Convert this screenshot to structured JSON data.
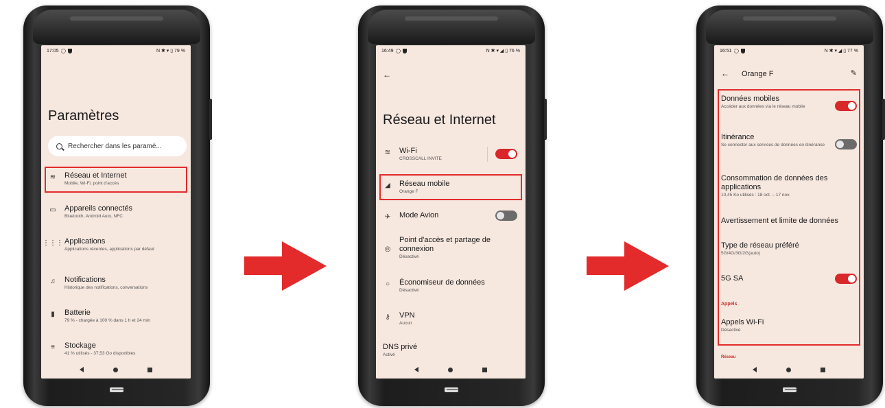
{
  "phone1": {
    "status_time": "17:05",
    "status_right": "N ✱ ▾ ▯ 79 %",
    "title": "Paramètres",
    "search_placeholder": "Rechercher dans les paramè...",
    "items": [
      {
        "title": "Réseau et Internet",
        "subtitle": "Mobile, Wi-Fi, point d'accès",
        "icon": "wifi-icon"
      },
      {
        "title": "Appareils connectés",
        "subtitle": "Bluetooth, Android Auto, NFC",
        "icon": "devices-icon"
      },
      {
        "title": "Applications",
        "subtitle": "Applications récentes, applications par défaut",
        "icon": "apps-grid-icon"
      },
      {
        "title": "Notifications",
        "subtitle": "Historique des notifications, conversations",
        "icon": "bell-icon"
      },
      {
        "title": "Batterie",
        "subtitle": "79 % - chargée à 100 % dans 1 h et 24 min",
        "icon": "battery-icon"
      },
      {
        "title": "Stockage",
        "subtitle": "41 % utilisés - 37,53 Go disponibles",
        "icon": "storage-icon"
      }
    ]
  },
  "phone2": {
    "status_time": "16:49",
    "status_right": "N ✱ ▾ ◢ ▯ 76 %",
    "title": "Réseau et Internet",
    "items": [
      {
        "title": "Wi-Fi",
        "subtitle": "CROSSCALL INVITE",
        "icon": "wifi-icon"
      },
      {
        "title": "Réseau mobile",
        "subtitle": "Orange F",
        "icon": "signal-icon"
      },
      {
        "title": "Mode Avion",
        "subtitle": "",
        "icon": "airplane-icon"
      },
      {
        "title": "Point d'accès et partage de connexion",
        "subtitle": "Désactivé",
        "icon": "hotspot-icon"
      },
      {
        "title": "Économiseur de données",
        "subtitle": "Désactivé",
        "icon": "data-saver-icon"
      },
      {
        "title": "VPN",
        "subtitle": "Aucun",
        "icon": "vpn-key-icon"
      },
      {
        "title": "DNS privé",
        "subtitle": "Activé",
        "icon": ""
      }
    ]
  },
  "phone3": {
    "status_time": "16:51",
    "status_right": "N ✱ ▾ ◢ ▯ 77 %",
    "header": "Orange F",
    "items": [
      {
        "title": "Données mobiles",
        "subtitle": "Accéder aux données via le réseau mobile"
      },
      {
        "title": "Itinérance",
        "subtitle": "Se connecter aux services de données en itinérance"
      },
      {
        "title": "Consommation de données des applications",
        "subtitle": "10,45 Ko utilisés : 18 oct. – 17 nov."
      },
      {
        "title": "Avertissement et limite de données",
        "subtitle": ""
      },
      {
        "title": "Type de réseau préféré",
        "subtitle": "5G/4G/3G/2G(auto)"
      },
      {
        "title": "5G SA",
        "subtitle": ""
      },
      {
        "title": "Appels Wi-Fi",
        "subtitle": "Désactivé"
      }
    ],
    "section_calls": "Appels",
    "section_network": "Réseau"
  },
  "toggles": {
    "wifi": true,
    "airplane": false,
    "mobile_data": true,
    "roaming": false,
    "5g_sa": true
  },
  "colors": {
    "accent": "#d9272a",
    "highlight": "#e32b2b",
    "screen_bg": "#f6e7df"
  }
}
